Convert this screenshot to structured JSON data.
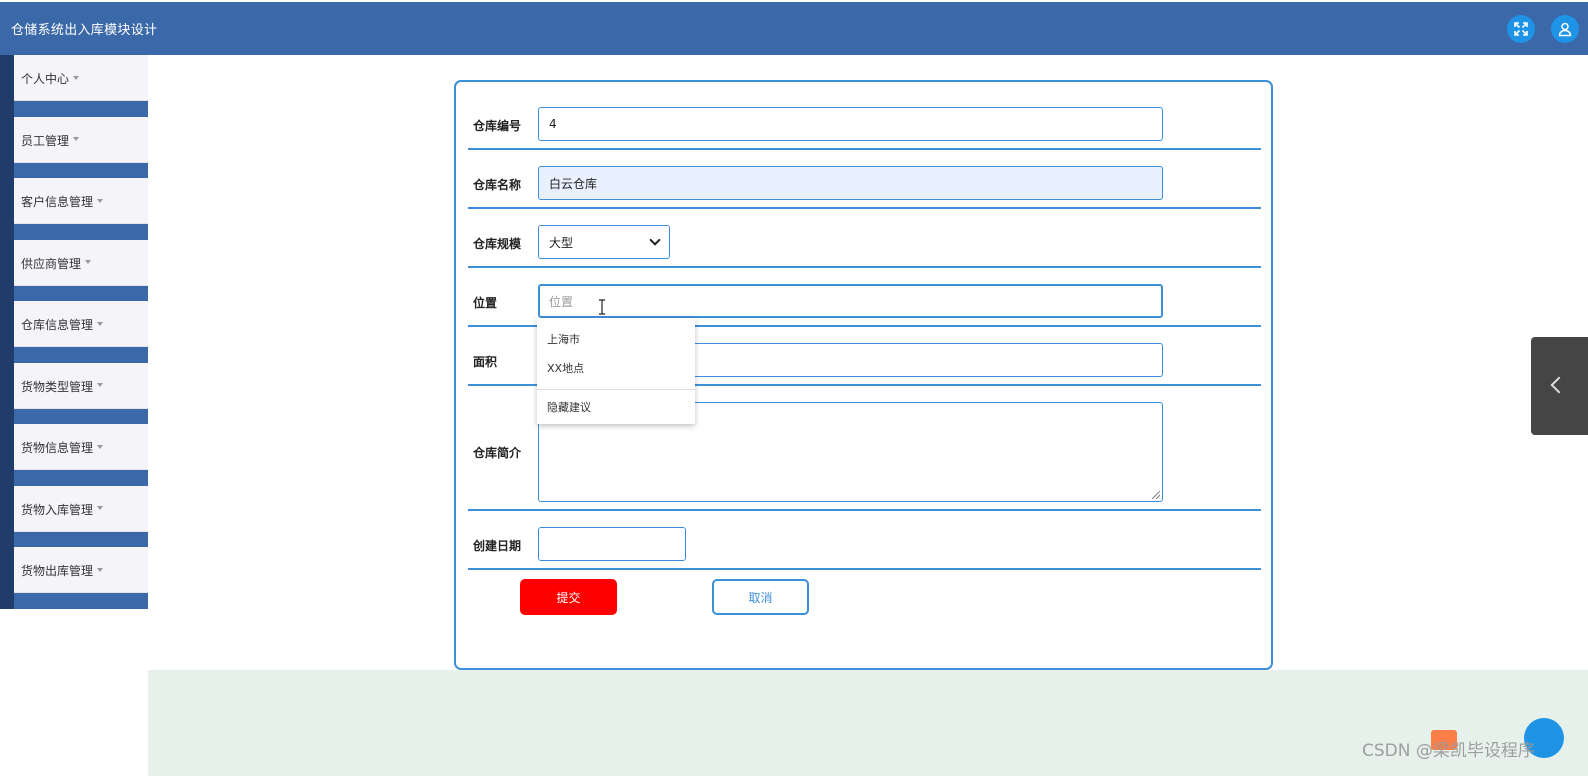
{
  "app": {
    "title": "仓储系统出入库模块设计"
  },
  "header": {
    "fullscreen_icon": "expand-icon",
    "user_icon": "user-icon"
  },
  "sidebar": {
    "items": [
      {
        "label": "个人中心"
      },
      {
        "label": "员工管理"
      },
      {
        "label": "客户信息管理"
      },
      {
        "label": "供应商管理"
      },
      {
        "label": "仓库信息管理"
      },
      {
        "label": "货物类型管理"
      },
      {
        "label": "货物信息管理"
      },
      {
        "label": "货物入库管理"
      },
      {
        "label": "货物出库管理"
      }
    ]
  },
  "form": {
    "warehouse_no": {
      "label": "仓库编号",
      "value": "4"
    },
    "warehouse_name": {
      "label": "仓库名称",
      "value": "白云仓库"
    },
    "warehouse_scale": {
      "label": "仓库规模",
      "selected": "大型"
    },
    "location": {
      "label": "位置",
      "placeholder": "位置",
      "value": ""
    },
    "area": {
      "label": "面积",
      "value": ""
    },
    "intro": {
      "label": "仓库简介",
      "value": ""
    },
    "created_date": {
      "label": "创建日期",
      "value": ""
    },
    "submit_label": "提交",
    "cancel_label": "取消"
  },
  "autocomplete": {
    "options": [
      "上海市",
      "XX地点"
    ],
    "hide_label": "隐藏建议"
  },
  "watermark": {
    "text": "CSDN @梁凯毕设程序"
  },
  "colors": {
    "header": "#3a68a9",
    "accent": "#3e8fda",
    "submit": "#ff0000",
    "bottom_band": "#e6f1eb"
  }
}
